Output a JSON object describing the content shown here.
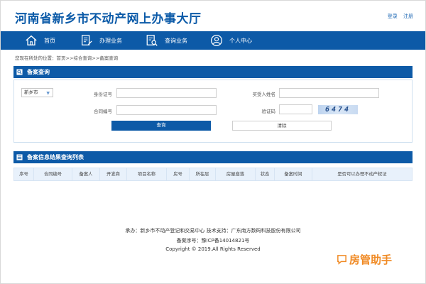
{
  "header": {
    "title": "河南省新乡市不动产网上办事大厅",
    "login": "登录",
    "register": "注册"
  },
  "nav": [
    {
      "label": "首页",
      "icon": "home-icon"
    },
    {
      "label": "办理业务",
      "icon": "form-edit-icon"
    },
    {
      "label": "查询业务",
      "icon": "search-document-icon"
    },
    {
      "label": "个人中心",
      "icon": "user-icon"
    }
  ],
  "breadcrumb": "您现在所处的位置：首页>>综合查询>>备案查询",
  "query_panel": {
    "title": "备案查询",
    "city_select": "新乡市",
    "id_label": "身份证号",
    "buyer_label": "买受人姓名",
    "contract_label": "合同编号",
    "captcha_label": "验证码",
    "captcha_text": "6474",
    "query_button": "查询",
    "clear_button": "清除"
  },
  "results_panel": {
    "title": "备案信息结果查询列表",
    "columns": [
      "序号",
      "合同编号",
      "备案人",
      "开发商",
      "项目名称",
      "房号",
      "所在层",
      "房屋座落",
      "状态",
      "备案时间",
      "是否可以办理不动产权证"
    ]
  },
  "footer": {
    "line1": "承办：新乡市不动产登记和交易中心   技术支持：广东南方数码科技股份有限公司",
    "line2": "备案序号：豫ICP备14014821号",
    "line3": "Copyright © 2019.All Rights Reserved"
  },
  "watermark": "房管助手",
  "colors": {
    "primary": "#0d5aa7",
    "accent": "#f08a24"
  }
}
